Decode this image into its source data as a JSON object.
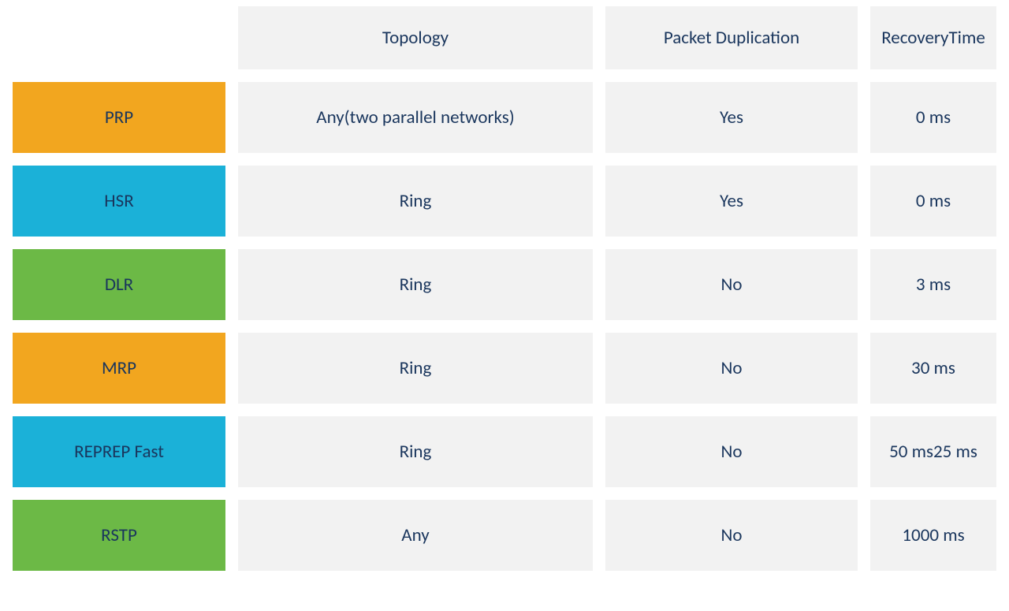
{
  "columns": {
    "topology": "Topology",
    "packet_duplication": "Packet Duplication",
    "recovery_time": "Recovery\nTime"
  },
  "rows": [
    {
      "label": "PRP",
      "color": "#f2a61f",
      "color_class": "bg-orange",
      "topology": "Any\n(two parallel networks)",
      "packet_duplication": "Yes",
      "recovery_time": "0 ms"
    },
    {
      "label": "HSR",
      "color": "#1bb1d8",
      "color_class": "bg-cyan",
      "topology": "Ring",
      "packet_duplication": "Yes",
      "recovery_time": "0 ms"
    },
    {
      "label": "DLR",
      "color": "#6cb946",
      "color_class": "bg-green",
      "topology": "Ring",
      "packet_duplication": "No",
      "recovery_time": "3 ms"
    },
    {
      "label": "MRP",
      "color": "#f2a61f",
      "color_class": "bg-orange",
      "topology": "Ring",
      "packet_duplication": "No",
      "recovery_time": "30 ms"
    },
    {
      "label": "REP\nREP Fast",
      "color": "#1bb1d8",
      "color_class": "bg-cyan",
      "topology": "Ring",
      "packet_duplication": "No",
      "recovery_time": "50 ms\n25 ms"
    },
    {
      "label": "RSTP",
      "color": "#6cb946",
      "color_class": "bg-green",
      "topology": "Any",
      "packet_duplication": "No",
      "recovery_time": "1000 ms"
    }
  ]
}
